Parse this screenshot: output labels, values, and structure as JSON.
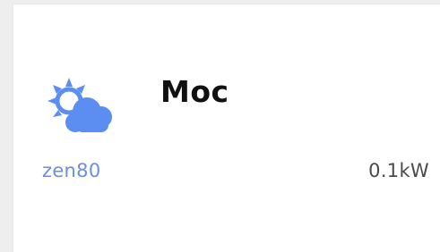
{
  "card": {
    "title": "Moc",
    "device_name": "zen80",
    "power": "0.1kW",
    "icon": "partly-cloudy-icon"
  },
  "colors": {
    "accent": "#6b8fe0",
    "icon_blue": "#5b8ef0",
    "title": "#111111",
    "value": "#4a4a4a"
  }
}
